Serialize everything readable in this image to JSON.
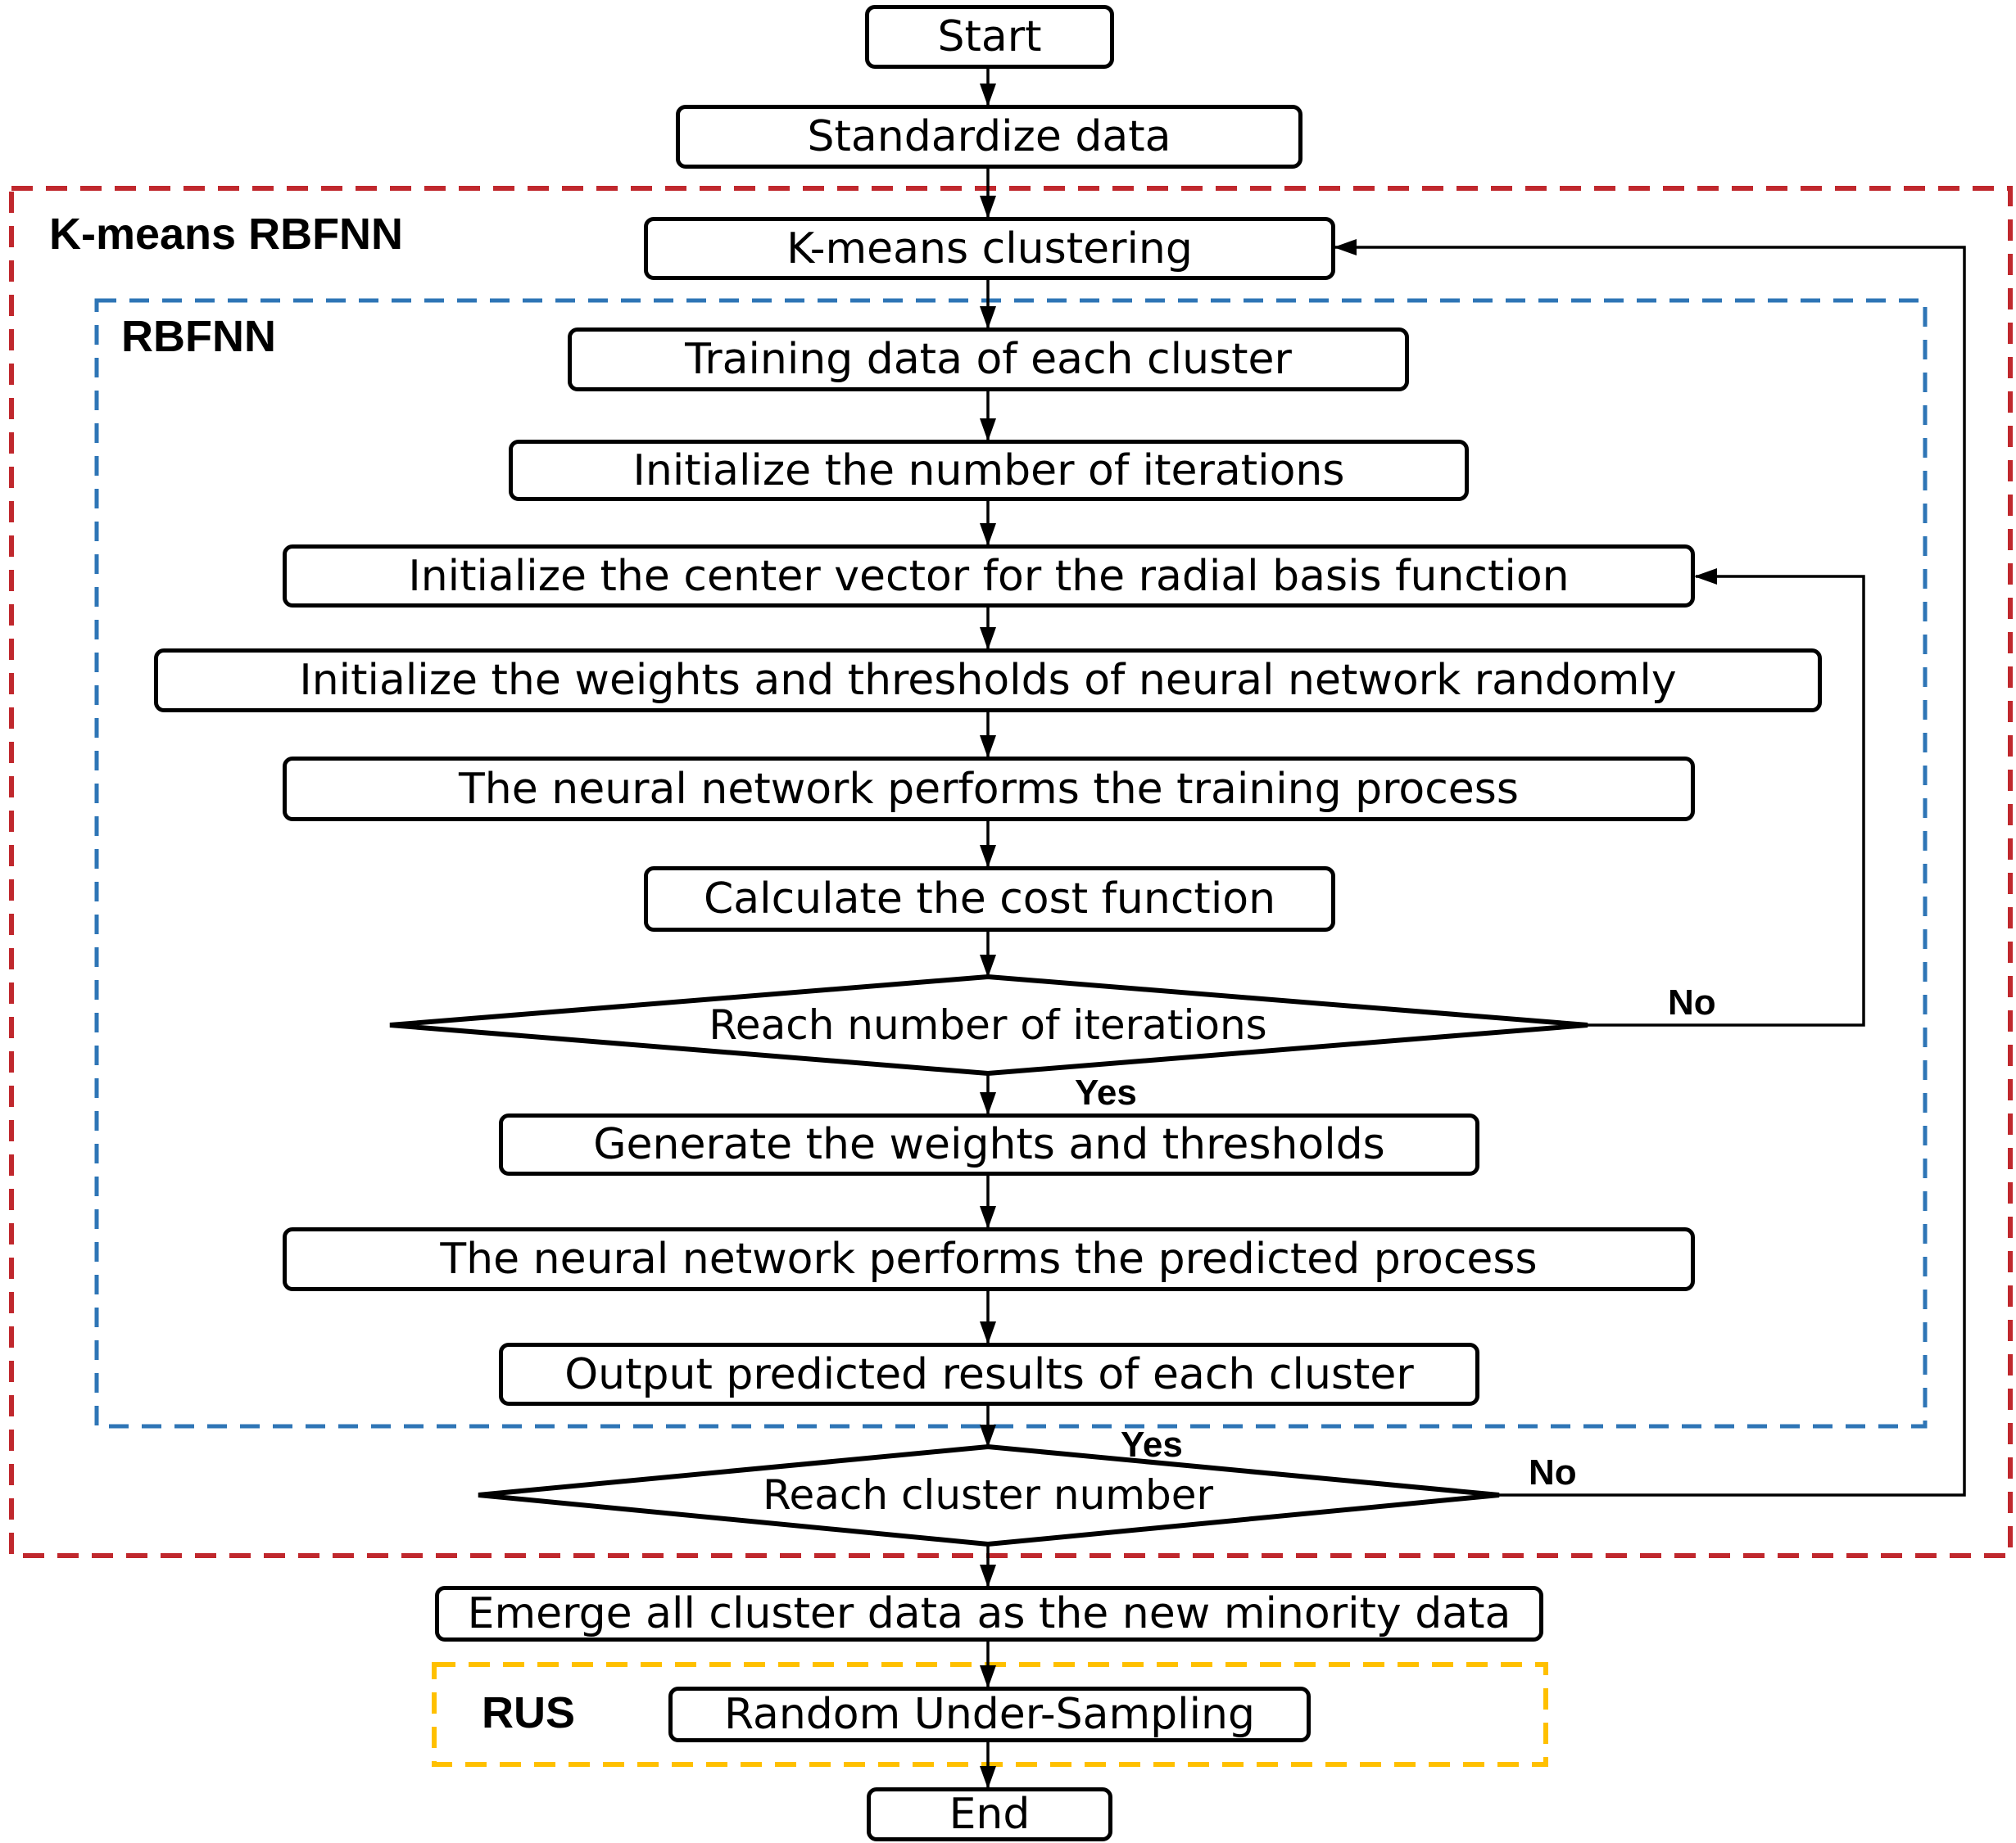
{
  "regions": {
    "kmeans_rbfnn": {
      "label": "K-means RBFNN",
      "color": "#c0282d"
    },
    "rbfnn": {
      "label": "RBFNN",
      "color": "#2e75b6"
    },
    "rus": {
      "label": "RUS",
      "color": "#ffc000"
    }
  },
  "nodes": {
    "start": "Start",
    "standardize": "Standardize data",
    "kmeans": "K-means clustering",
    "training_data": "Training data of each cluster",
    "init_iterations": "Initialize the number of iterations",
    "init_center": "Initialize the center vector for the radial basis function",
    "init_weights": "Initialize the weights and thresholds of neural network randomly",
    "training_process": "The neural network performs the training process",
    "cost_function": "Calculate the cost function",
    "decision_iterations": "Reach number of iterations",
    "generate_weights": "Generate the weights and thresholds",
    "predicted_process": "The neural network performs the predicted process",
    "output_results": "Output predicted results of each cluster",
    "decision_cluster": "Reach cluster number",
    "emerge": "Emerge all cluster data as the new minority data",
    "rus": "Random Under-Sampling",
    "end": "End"
  },
  "edge_labels": {
    "iterations_no": "No",
    "iterations_yes": "Yes",
    "cluster_yes": "Yes",
    "cluster_no": "No"
  }
}
